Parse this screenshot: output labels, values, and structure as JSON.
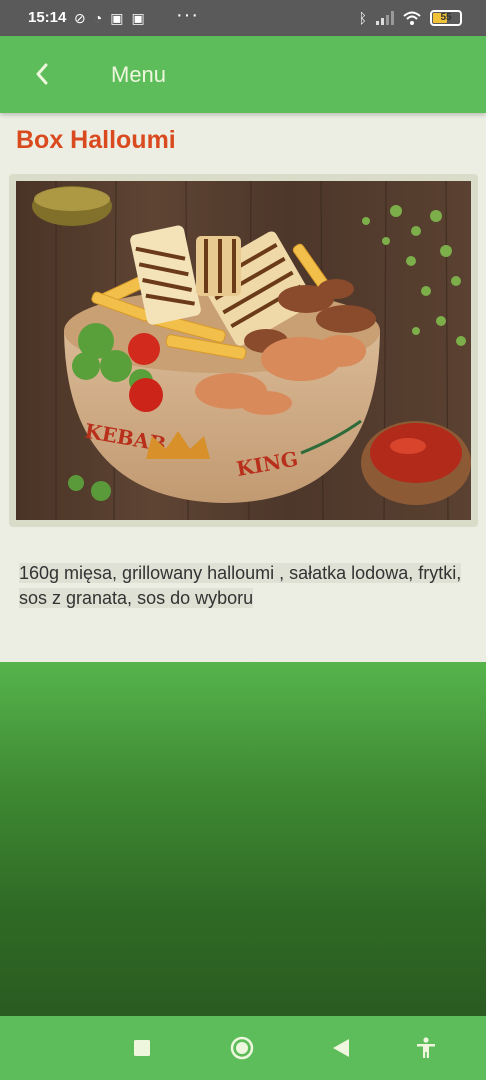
{
  "status_bar": {
    "time": "15:14",
    "battery_level": "55",
    "battery_fraction": 0.55
  },
  "app_bar": {
    "title": "Menu"
  },
  "product": {
    "title": "Box Halloumi",
    "description": "160g mięsa, grillowany halloumi , sałatka lodowa, frytki, sos z granata, sos do wyboru",
    "image_brand_text": {
      "left": "KEBAB",
      "right": "KING"
    }
  },
  "colors": {
    "app_bar": "#5cbd5a",
    "title_accent": "#d94a1f",
    "background": "#eceee3",
    "panel_dark_green": "#2f6a25"
  },
  "icons": {
    "back": "chevron-left-icon",
    "nav_recents": "square-icon",
    "nav_home": "circle-icon",
    "nav_back": "triangle-left-icon",
    "nav_accessibility": "accessibility-icon"
  }
}
